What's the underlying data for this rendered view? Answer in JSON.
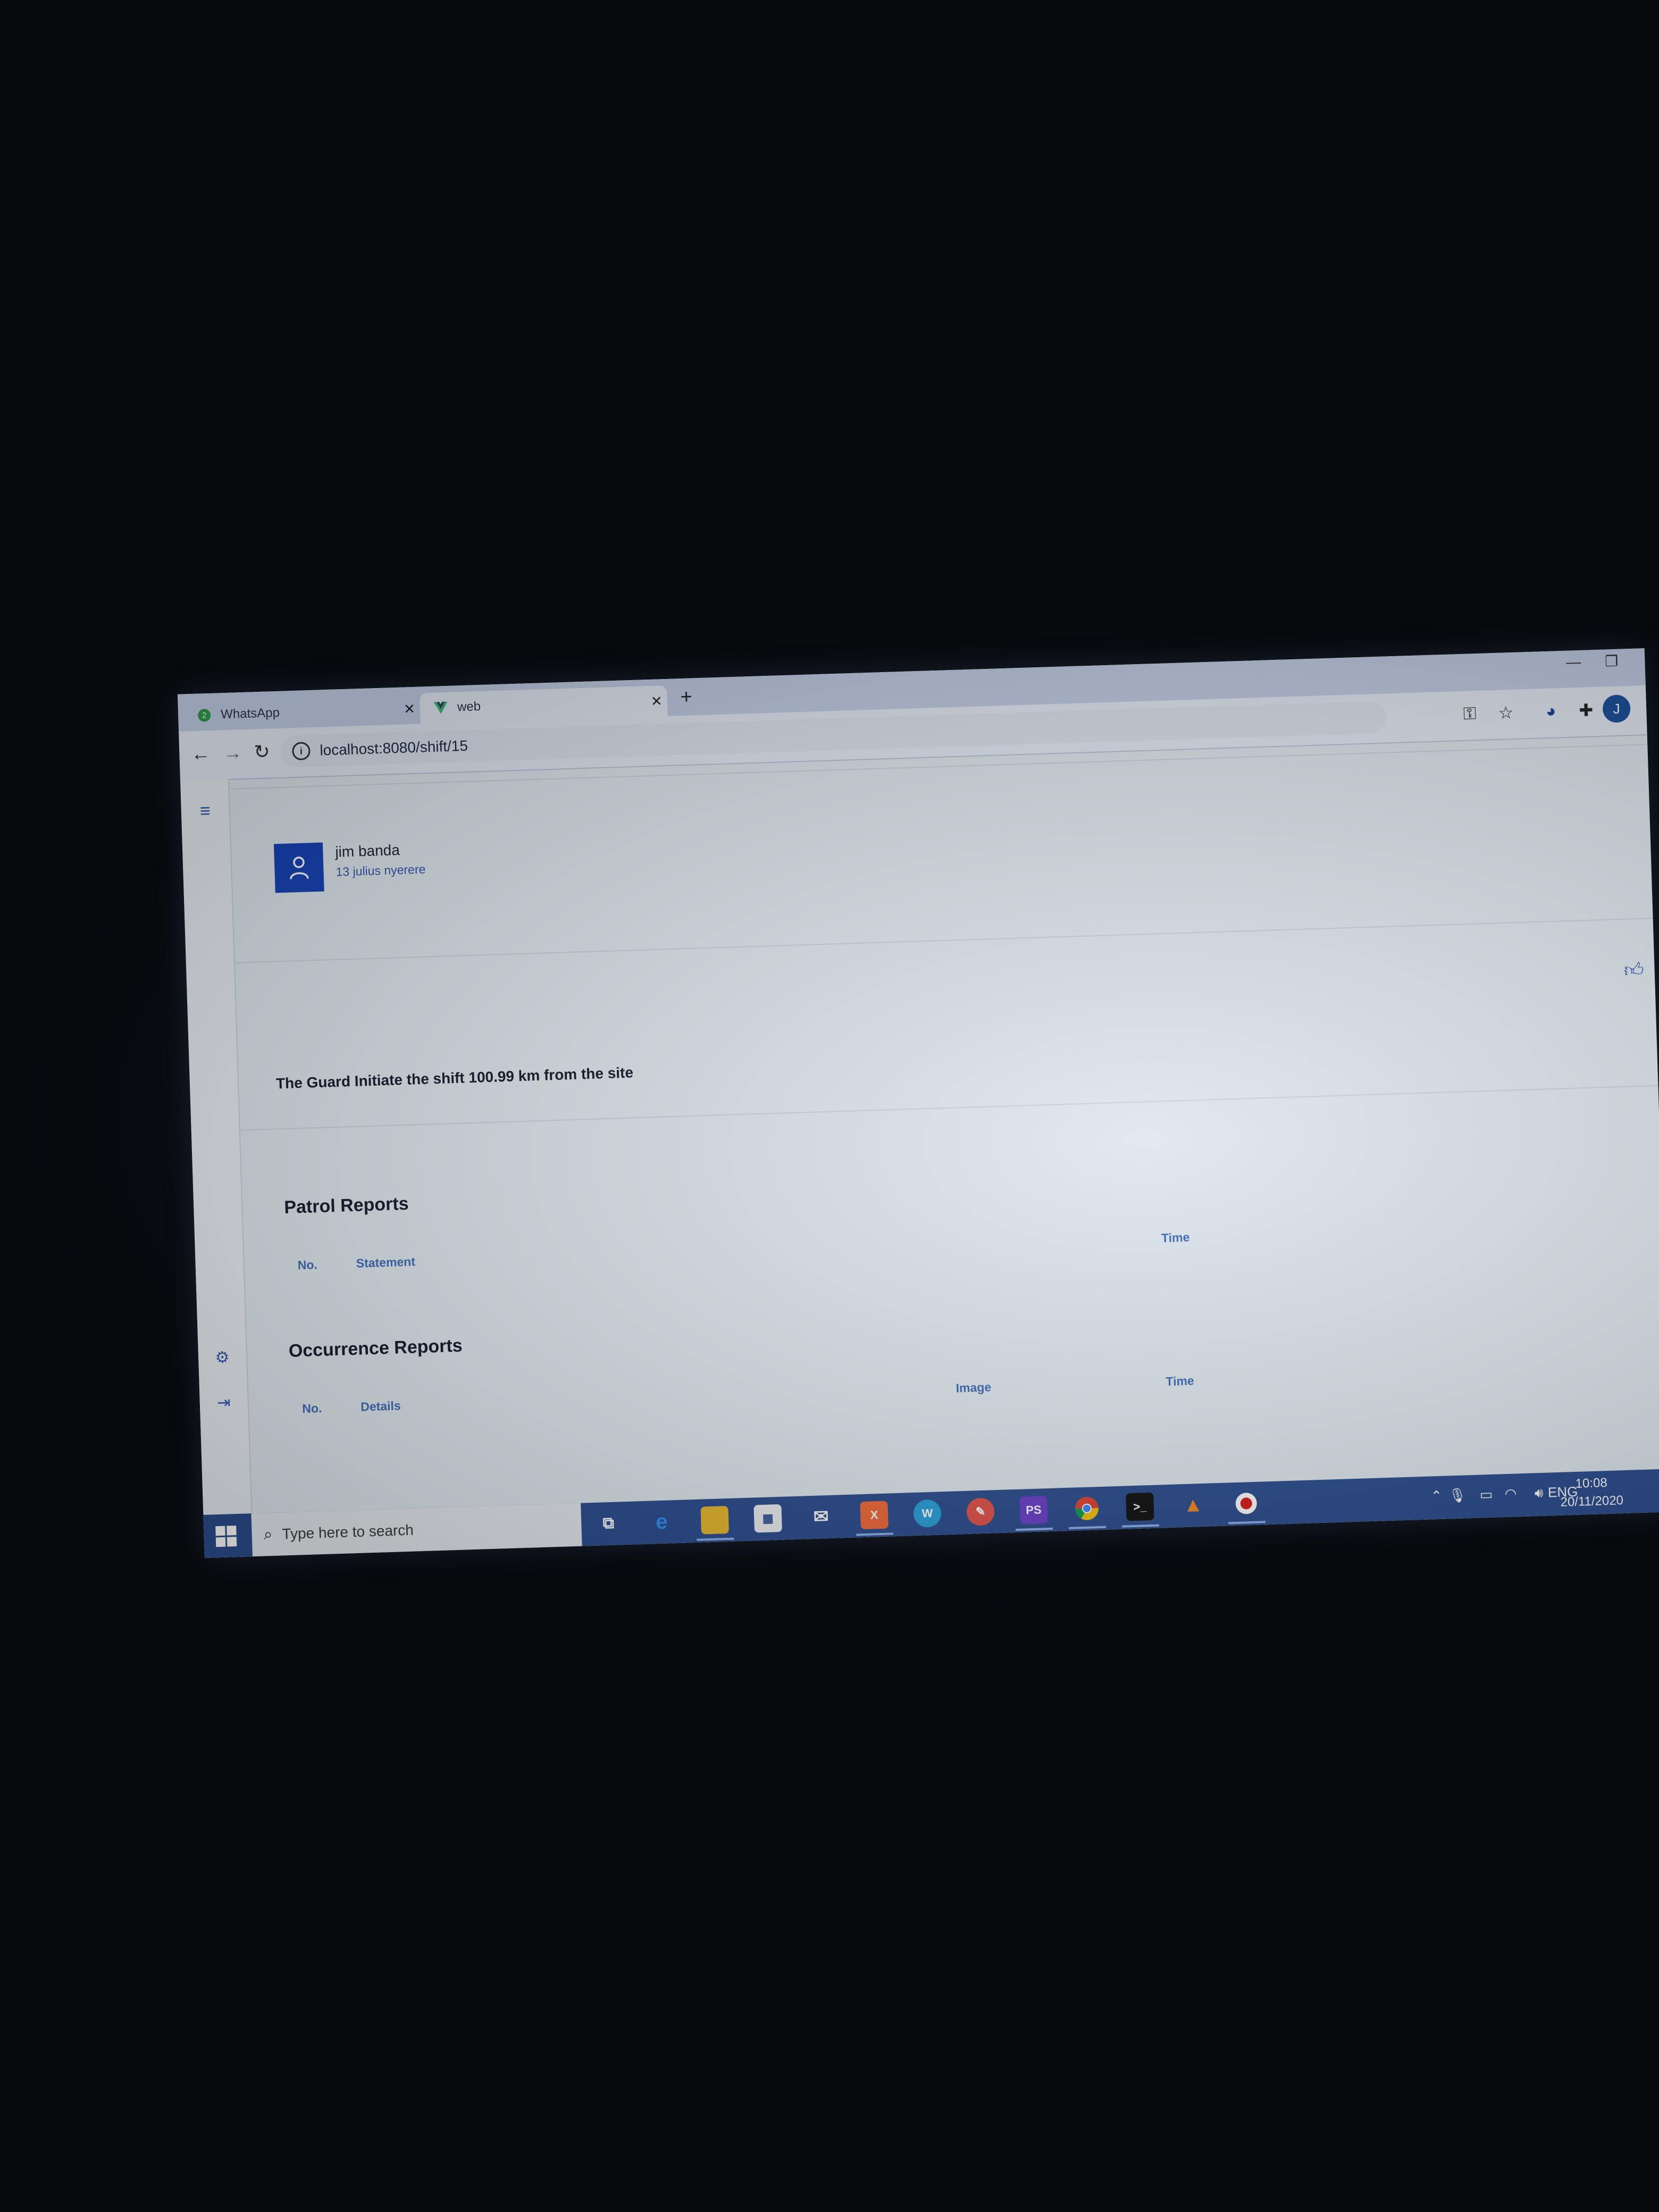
{
  "browser": {
    "tabs": [
      {
        "title": "WhatsApp",
        "badge": "2",
        "active": false
      },
      {
        "title": "web",
        "active": true
      }
    ],
    "url": "localhost:8080/shift/15"
  },
  "user": {
    "name": "jim banda",
    "address": "13 julius nyerere"
  },
  "shift_statement": "The Guard Initiate the shift 100.99 km from the site",
  "patrol_reports": {
    "title": "Patrol Reports",
    "columns": [
      "No.",
      "Statement",
      "Time"
    ]
  },
  "occurrence_reports": {
    "title": "Occurrence Reports",
    "columns": [
      "No.",
      "Details",
      "Image",
      "Time"
    ]
  },
  "taskbar": {
    "search_placeholder": "Type here to search",
    "language": "ENG",
    "time": "10:08",
    "date": "20/11/2020",
    "apps": [
      "task-view",
      "edge",
      "file-explorer",
      "store",
      "mail",
      "xampp",
      "app",
      "app",
      "phpstorm",
      "chrome",
      "terminal",
      "vlc",
      "recorder"
    ]
  },
  "colors": {
    "accent": "#1743b8",
    "header_text": "#3f6ab8",
    "taskbar": "#2b4d8f"
  }
}
